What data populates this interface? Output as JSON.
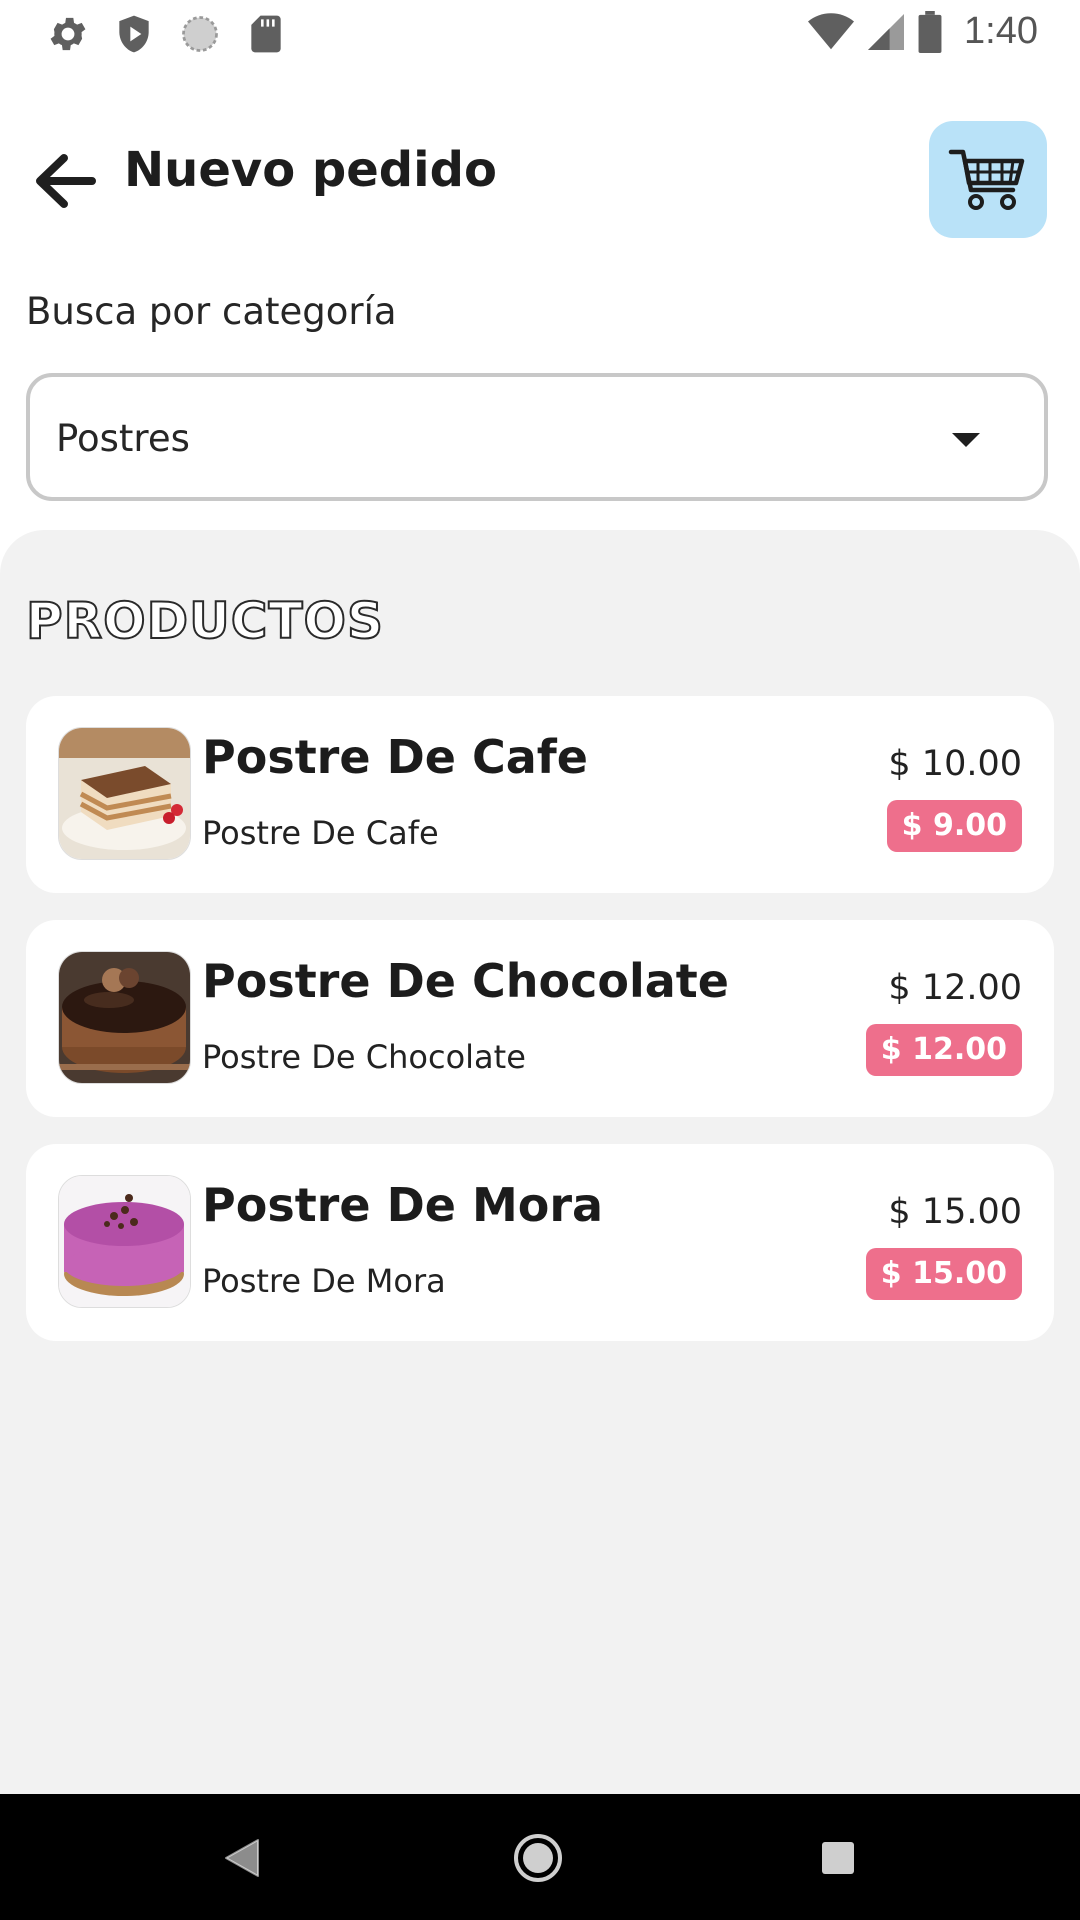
{
  "status_bar": {
    "time": "1:40",
    "left_icons": [
      "settings-icon",
      "shield-icon",
      "sync-icon",
      "sd-card-icon"
    ],
    "right_icons": [
      "wifi-icon",
      "signal-icon",
      "battery-icon"
    ]
  },
  "header": {
    "title": "Nuevo pedido",
    "back_icon": "arrow-left-icon",
    "cart_icon": "shopping-cart-icon",
    "cart_button_color": "#b9e2f8"
  },
  "filter": {
    "label": "Busca por categoría",
    "selected": "Postres"
  },
  "products": {
    "section_title": "PRODUCTOS",
    "items": [
      {
        "name": "Postre De Cafe",
        "description": "Postre De Cafe",
        "price": "$ 10.00",
        "sale_price": "$ 9.00"
      },
      {
        "name": "Postre De Chocolate",
        "description": "Postre De Chocolate",
        "price": "$ 12.00",
        "sale_price": "$ 12.00"
      },
      {
        "name": "Postre De Mora",
        "description": "Postre De Mora",
        "price": "$ 15.00",
        "sale_price": "$ 15.00"
      }
    ]
  },
  "colors": {
    "sale_badge": "#ee6f8c",
    "panel_background": "#f2f2f2"
  },
  "nav_bar": {
    "icons": [
      "nav-back-icon",
      "nav-home-icon",
      "nav-recents-icon"
    ]
  }
}
